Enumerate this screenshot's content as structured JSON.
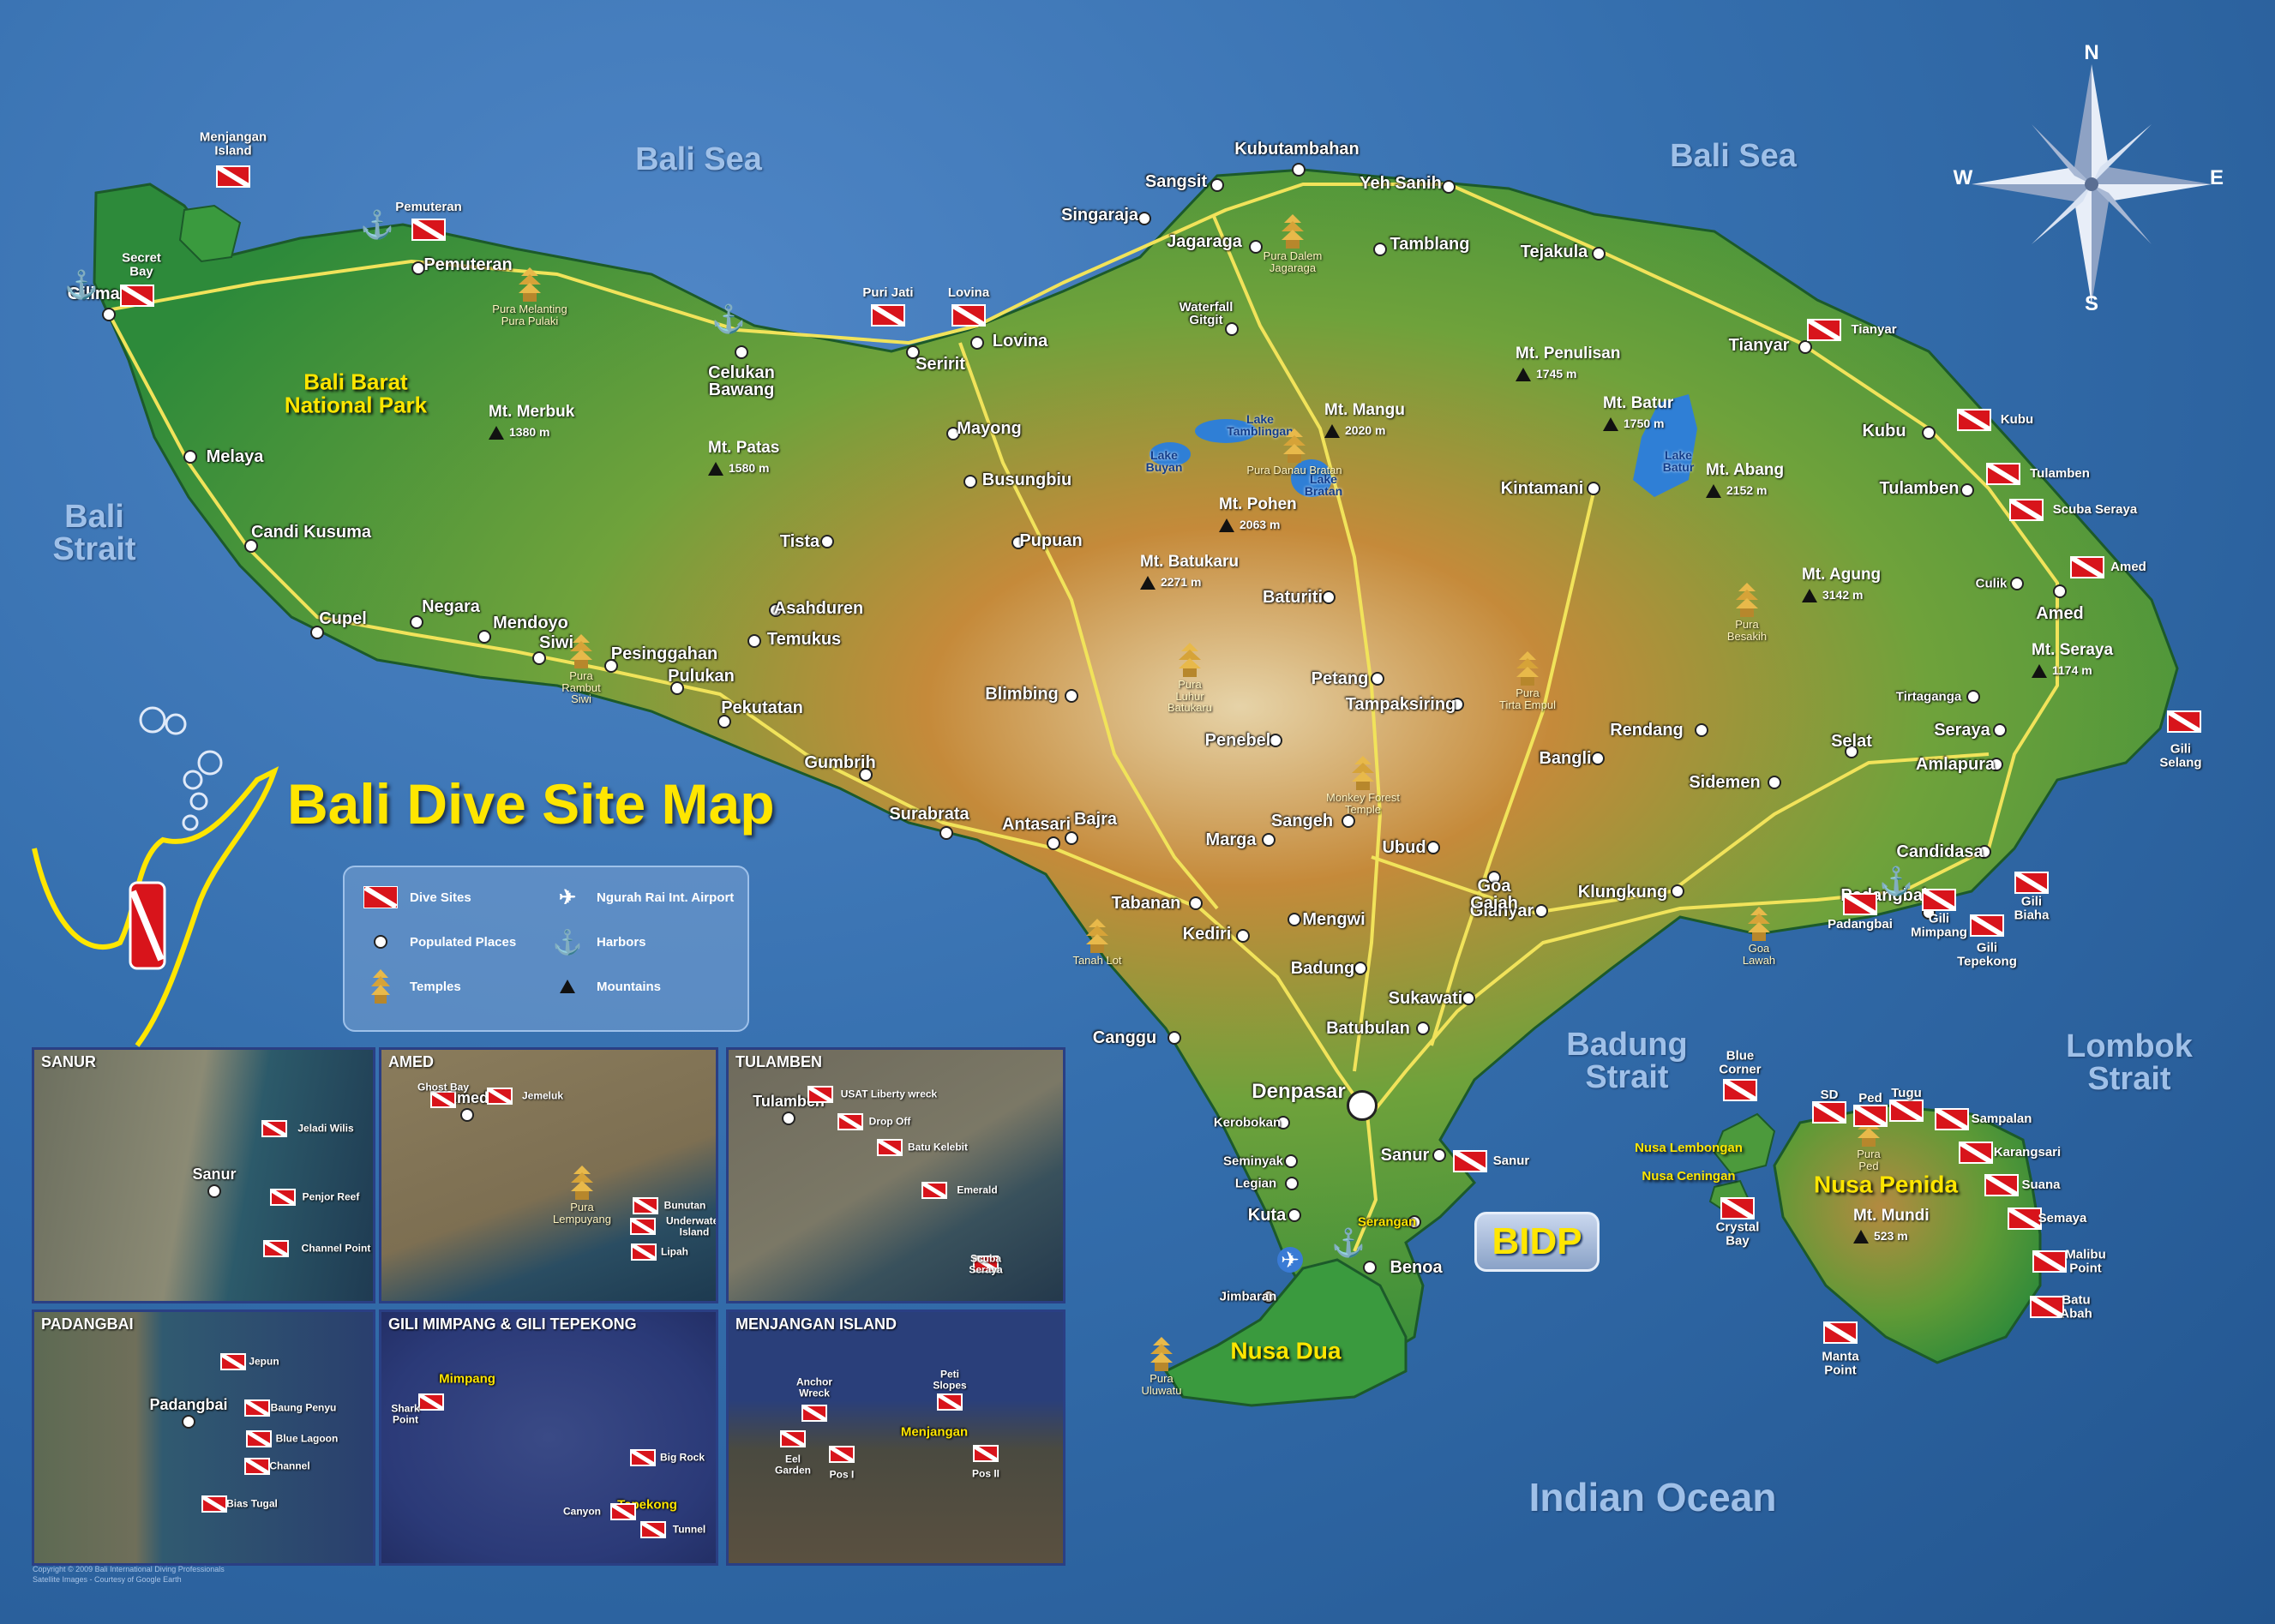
{
  "title": "Bali Dive Site Map",
  "seas": [
    {
      "id": "bali-sea-west",
      "text": "Bali Sea"
    },
    {
      "id": "bali-sea-east",
      "text": "Bali Sea"
    },
    {
      "id": "bali-strait",
      "text": "Bali\nStrait"
    },
    {
      "id": "badung-strait",
      "text": "Badung\nStrait"
    },
    {
      "id": "lombok-strait",
      "text": "Lombok\nStrait"
    },
    {
      "id": "indian-ocean",
      "text": "Indian Ocean"
    }
  ],
  "compass": {
    "n": "N",
    "s": "S",
    "e": "E",
    "w": "W"
  },
  "regions": [
    {
      "id": "bali-barat",
      "text": "Bali Barat\nNational Park"
    },
    {
      "id": "nusa-dua",
      "text": "Nusa Dua"
    },
    {
      "id": "nusa-penida",
      "text": "Nusa Penida"
    },
    {
      "id": "nusa-lembongan",
      "text": "Nusa Lembongan"
    },
    {
      "id": "nusa-ceningan",
      "text": "Nusa Ceningan"
    }
  ],
  "places": [
    "Gilimanuk",
    "Pemuteran",
    "Melaya",
    "Candi Kusuma",
    "Cupel",
    "Negara",
    "Mendoyo",
    "Siwi",
    "Pesinggahan",
    "Pulukan",
    "Pekutatan",
    "Gumbrih",
    "Surabrata",
    "Antasari",
    "Bajra",
    "Celukan\nBawang",
    "Seririt",
    "Lovina",
    "Mayong",
    "Busungbiu",
    "Tista",
    "Pupuan",
    "Asahduren",
    "Temukus",
    "Blimbing",
    "Singaraja",
    "Sangsit",
    "Kubutambahan",
    "Jagaraga",
    "Yeh Sanih",
    "Tamblang",
    "Tejakula",
    "Tianyar",
    "Kubu",
    "Tulamben",
    "Kintamani",
    "Amed",
    "Culik",
    "Tirtaganga",
    "Seraya",
    "Amlapura",
    "Candidasa",
    "Padangbai",
    "Selat",
    "Sidemen",
    "Rendang",
    "Bangli",
    "Tampaksiring",
    "Klungkung",
    "Gianyar",
    "Goa\nGajah",
    "Ubud",
    "Sangeh",
    "Petang",
    "Baturiti",
    "Penebel",
    "Marga",
    "Tabanan",
    "Kediri",
    "Mengwi",
    "Badung",
    "Sukawati",
    "Batubulan",
    "Canggu",
    "Denpasar",
    "Kerobokan",
    "Seminyak",
    "Legian",
    "Kuta",
    "Sanur",
    "Serangan",
    "Benoa",
    "Jimbaran",
    "Waterfall\nGitgit"
  ],
  "lakes": [
    "Lake\nTamblingan",
    "Lake\nBuyan",
    "Lake\nBratan",
    "Lake\nBatur"
  ],
  "mountains": [
    {
      "name": "Mt. Merbuk",
      "elev": "1380 m"
    },
    {
      "name": "Mt. Patas",
      "elev": "1580 m"
    },
    {
      "name": "Mt. Mangu",
      "elev": "2020 m"
    },
    {
      "name": "Mt. Pohen",
      "elev": "2063 m"
    },
    {
      "name": "Mt. Batukaru",
      "elev": "2271 m"
    },
    {
      "name": "Mt. Penulisan",
      "elev": "1745 m"
    },
    {
      "name": "Mt. Batur",
      "elev": "1750 m"
    },
    {
      "name": "Mt. Abang",
      "elev": "2152 m"
    },
    {
      "name": "Mt. Agung",
      "elev": "3142 m"
    },
    {
      "name": "Mt. Seraya",
      "elev": "1174 m"
    },
    {
      "name": "Mt. Mundi",
      "elev": "523 m"
    }
  ],
  "temples": [
    "Pura Melanting\nPura Pulaki",
    "Pura\nRambut\nSiwi",
    "Pura Dalem\nJagaraga",
    "Pura Danau Bratan",
    "Pura\nLuhur\nBatukaru",
    "Monkey Forest\nTemple",
    "Pura\nTirta Empul",
    "Pura\nBesakih",
    "Goa\nLawah",
    "Tanah Lot",
    "Pura\nUluwatu",
    "Pura\nPed"
  ],
  "dive_sites": [
    "Menjangan\nIsland",
    "Secret\nBay",
    "Pemuteran",
    "Puri Jati",
    "Lovina",
    "Tianyar",
    "Kubu",
    "Tulamben",
    "Scuba Seraya",
    "Amed",
    "Gili\nSelang",
    "Padangbai",
    "Gili\nMimpang",
    "Gili\nTepekong",
    "Gili\nBiaha",
    "Sanur",
    "Blue\nCorner",
    "Crystal\nBay",
    "SD",
    "Ped",
    "Tugu",
    "Sampalan",
    "Karangsari",
    "Suana",
    "Semaya",
    "Malibu\nPoint",
    "Batu\nAbah",
    "Manta\nPoint"
  ],
  "legend": {
    "dive_sites": "Dive Sites",
    "populated": "Populated Places",
    "temples": "Temples",
    "airport": "Ngurah Rai Int. Airport",
    "harbors": "Harbors",
    "mountains": "Mountains"
  },
  "brand": "BIDP",
  "insets": [
    {
      "title": "SANUR",
      "places": [
        "Sanur"
      ],
      "sites": [
        "Jeladi Wilis",
        "Penjor Reef",
        "Channel Point"
      ]
    },
    {
      "title": "AMED",
      "places": [
        "Amed"
      ],
      "sites": [
        "Ghost Bay",
        "Jemeluk",
        "Bunutan",
        "Underwater\nIsland",
        "Lipah"
      ],
      "temples": [
        "Pura\nLempuyang"
      ]
    },
    {
      "title": "TULAMBEN",
      "places": [
        "Tulamben"
      ],
      "sites": [
        "USAT Liberty wreck",
        "Drop Off",
        "Batu Kelebit",
        "Emerald",
        "Scuba\nSeraya"
      ]
    },
    {
      "title": "PADANGBAI",
      "places": [
        "Padangbai"
      ],
      "sites": [
        "Jepun",
        "Baung Penyu",
        "Blue Lagoon",
        "Channel",
        "Bias Tugal"
      ]
    },
    {
      "title": "GILI MIMPANG & GILI TEPEKONG",
      "places": [
        "Mimpang",
        "Tepekong"
      ],
      "sites": [
        "Shark\nPoint",
        "Big Rock",
        "Canyon",
        "Tunnel"
      ]
    },
    {
      "title": "MENJANGAN ISLAND",
      "places": [
        "Menjangan"
      ],
      "sites": [
        "Peti\nSlopes",
        "Anchor\nWreck",
        "Eel\nGarden",
        "Pos I",
        "Pos II"
      ]
    }
  ],
  "copyright": "Copyright © 2009 Bali International Diving Professionals\nSatellite Images - Courtesy of Google Earth",
  "colors": {
    "ocean": "#356fae",
    "land_low": "#2e8a3a",
    "land_high": "#c08a3a",
    "road": "#f1e35a",
    "title": "#ffe600",
    "dive_red": "#d8141b"
  }
}
